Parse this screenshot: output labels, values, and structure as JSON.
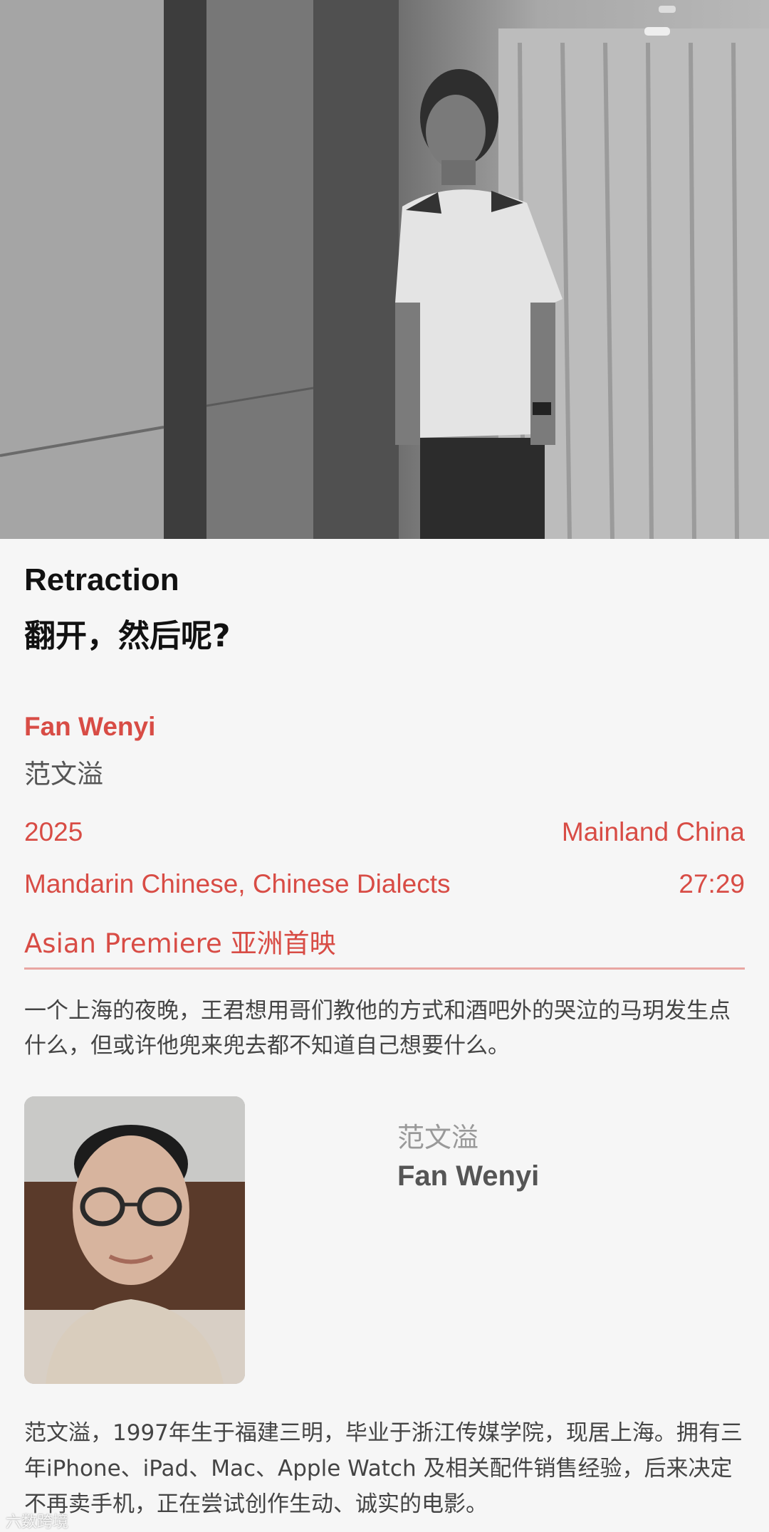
{
  "film": {
    "title_en": "Retraction",
    "title_zh": "翻开，然后呢?"
  },
  "director": {
    "name_en": "Fan Wenyi",
    "name_zh": "范文溢"
  },
  "meta": {
    "year": "2025",
    "country": "Mainland China",
    "language": "Mandarin Chinese, Chinese Dialects",
    "runtime": "27:29",
    "premiere": "Asian Premiere 亚洲首映"
  },
  "synopsis": "一个上海的夜晚，王君想用哥们教他的方式和酒吧外的哭泣的马玥发生点什么，但或许他兜来兜去都不知道自己想要什么。",
  "bio": {
    "name_zh": "范文溢",
    "name_en": "Fan Wenyi",
    "text": "范文溢，1997年生于福建三明，毕业于浙江传媒学院，现居上海。拥有三年iPhone、iPad、Mac、Apple Watch 及相关配件销售经验，后来决定不再卖手机，正在尝试创作生动、诚实的电影。"
  },
  "watermark": "六数跨境",
  "colors": {
    "accent": "#d84c45",
    "background": "#f6f6f6",
    "divider": "#e8a6a2"
  }
}
